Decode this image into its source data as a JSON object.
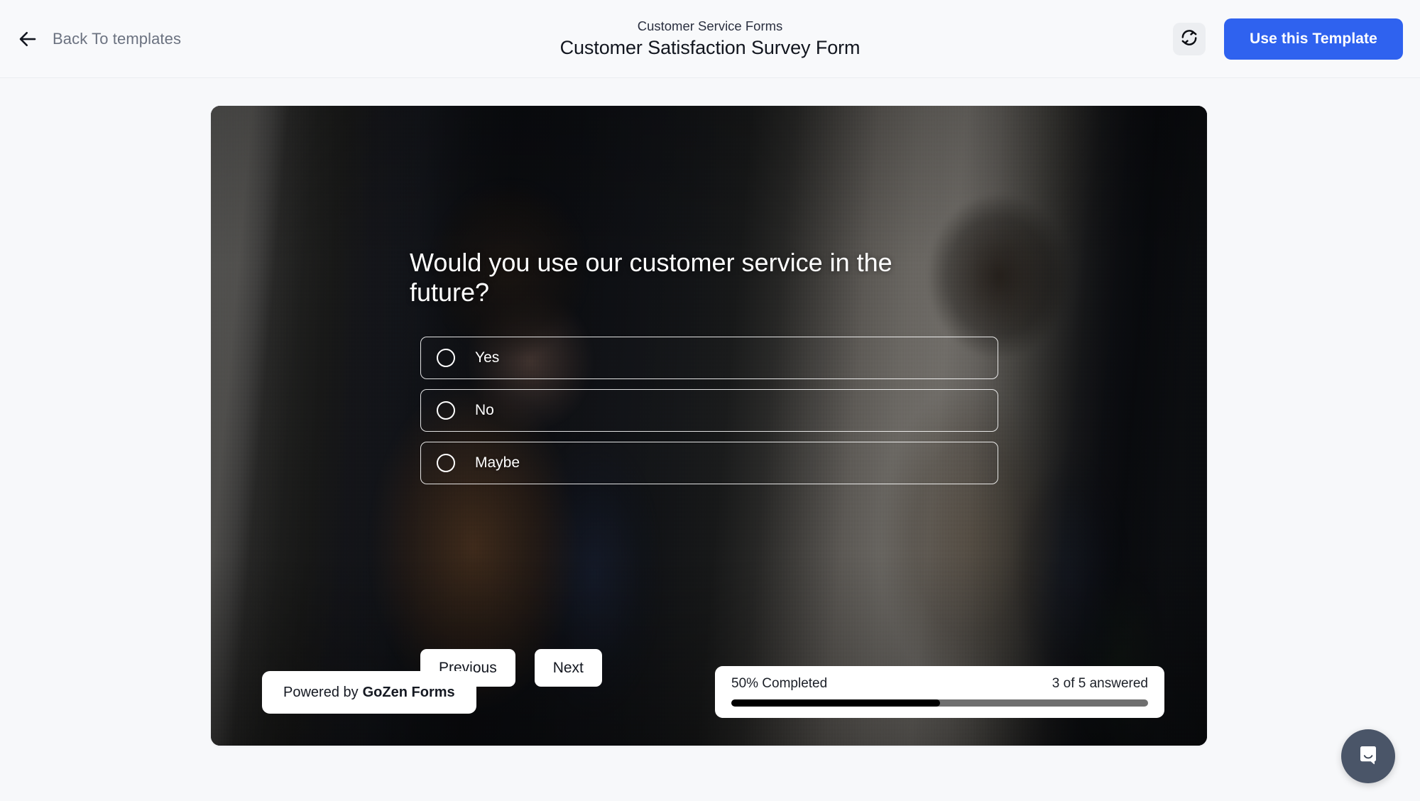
{
  "topbar": {
    "back_label": "Back To templates",
    "back_icon": "arrow-left-icon",
    "eyebrow": "Customer Service Forms",
    "title": "Customer Satisfaction Survey Form",
    "refresh_icon": "sync-refresh-icon",
    "use_template_label": "Use this Template"
  },
  "form": {
    "question": "Would you use our customer service in the future?",
    "options": [
      {
        "label": "Yes",
        "selected": false
      },
      {
        "label": "No",
        "selected": false
      },
      {
        "label": "Maybe",
        "selected": false
      }
    ],
    "previous_label": "Previous",
    "next_label": "Next",
    "powered_prefix": "Powered by",
    "powered_brand": "GoZen Forms",
    "progress": {
      "percent_label": "50% Completed",
      "answered_label": "3 of 5 answered",
      "percent_value": 50,
      "answered": 3,
      "total": 5
    }
  },
  "chat": {
    "icon": "chat-bubble-smile-icon"
  },
  "colors": {
    "accent_blue": "#2f62ef",
    "page_background": "#f7f8fa",
    "card_dark": "#15171c",
    "chat_bubble": "#4a5568",
    "progress_fill": "#000000",
    "progress_track": "#6f6f6f"
  }
}
